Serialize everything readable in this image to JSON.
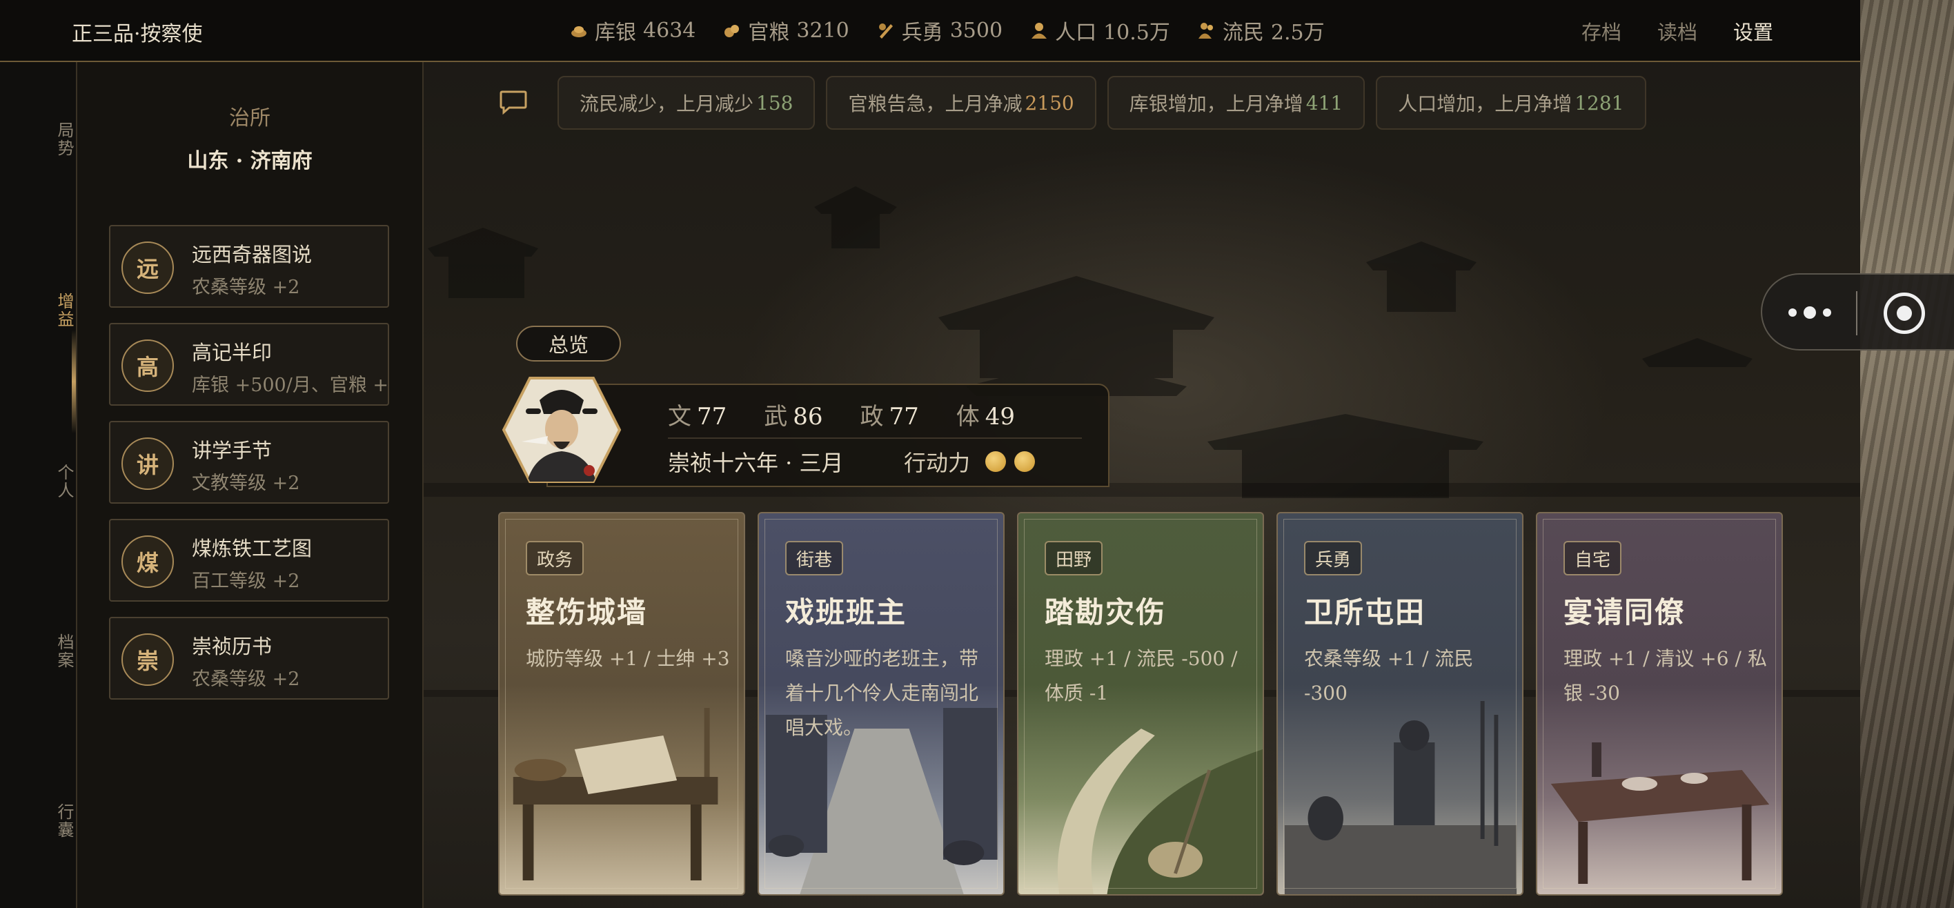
{
  "header": {
    "rank": "正三品·按察使",
    "resources": [
      {
        "icon": "silver-icon",
        "label": "库银",
        "value": "4634"
      },
      {
        "icon": "grain-icon",
        "label": "官粮",
        "value": "3210"
      },
      {
        "icon": "soldier-icon",
        "label": "兵勇",
        "value": "3500"
      },
      {
        "icon": "population-icon",
        "label": "人口",
        "value": "10.5万"
      },
      {
        "icon": "refugee-icon",
        "label": "流民",
        "value": "2.5万"
      }
    ],
    "menu": {
      "save": "存档",
      "load": "读档",
      "settings": "设置"
    }
  },
  "leftnav": {
    "items": [
      {
        "label": "局势",
        "active": false
      },
      {
        "label": "增益",
        "active": true
      },
      {
        "label": "个人",
        "active": false
      },
      {
        "label": "档案",
        "active": false
      },
      {
        "label": "行囊",
        "active": false
      }
    ]
  },
  "panel": {
    "label": "治所",
    "place": "山东 · 济南府",
    "books": [
      {
        "seal": "远",
        "title": "远西奇器图说",
        "effect": "农桑等级 +2"
      },
      {
        "seal": "高",
        "title": "高记半印",
        "effect": "库银 +500/月、官粮 +"
      },
      {
        "seal": "讲",
        "title": "讲学手节",
        "effect": "文教等级 +2"
      },
      {
        "seal": "煤",
        "title": "煤炼铁工艺图",
        "effect": "百工等级 +2"
      },
      {
        "seal": "崇",
        "title": "崇祯历书",
        "effect": "农桑等级 +2"
      }
    ]
  },
  "news": [
    {
      "text": "流民减少，上月减少",
      "value": "158",
      "trend": "up"
    },
    {
      "text": "官粮告急，上月净减",
      "value": "2150",
      "trend": "down"
    },
    {
      "text": "库银增加，上月净增",
      "value": "411",
      "trend": "up"
    },
    {
      "text": "人口增加，上月净增",
      "value": "1281",
      "trend": "up"
    }
  ],
  "overview": {
    "tab": "总览",
    "stats": [
      {
        "label": "文",
        "value": "77"
      },
      {
        "label": "武",
        "value": "86"
      },
      {
        "label": "政",
        "value": "77"
      },
      {
        "label": "体",
        "value": "49"
      }
    ],
    "date": "崇祯十六年 · 三月",
    "action_label": "行动力",
    "action_points": 2
  },
  "cards": [
    {
      "tag": "政务",
      "title": "整饬城墙",
      "desc": "城防等级 +1 / 士绅 +3",
      "color": "#6b5a40"
    },
    {
      "tag": "街巷",
      "title": "戏班班主",
      "desc": "嗓音沙哑的老班主，带着十几个伶人走南闯北唱大戏。",
      "color": "#4c5066"
    },
    {
      "tag": "田野",
      "title": "踏勘灾伤",
      "desc": "理政 +1 / 流民 -500 / 体质 -1",
      "color": "#4f5c3d"
    },
    {
      "tag": "兵勇",
      "title": "卫所屯田",
      "desc": "农桑等级 +1 / 流民 -300",
      "color": "#434a56"
    },
    {
      "tag": "自宅",
      "title": "宴请同僚",
      "desc": "理政 +1 / 清议 +6 / 私银 -30",
      "color": "#574a55"
    }
  ],
  "colors": {
    "accent": "#c7a162",
    "up": "#8ea376",
    "down": "#c99a5b"
  }
}
